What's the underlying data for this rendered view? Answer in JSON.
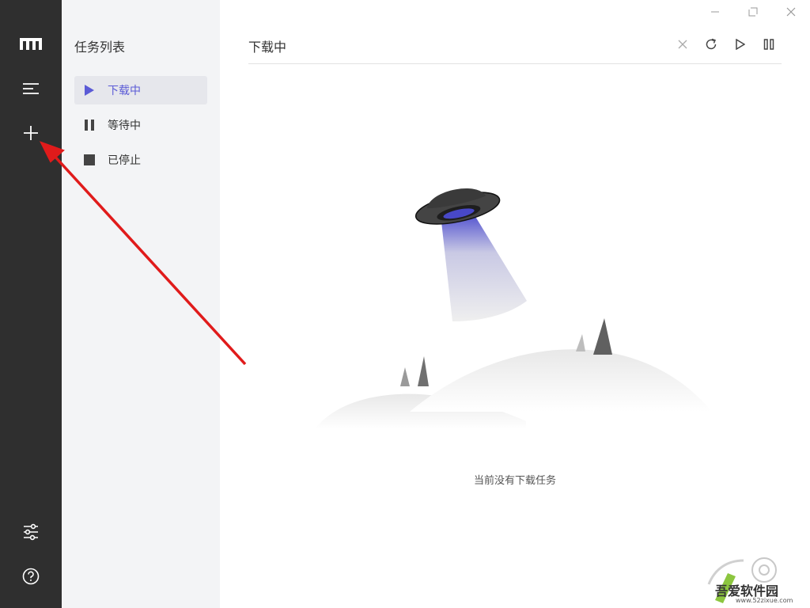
{
  "rail": {
    "logo_icon": "logo-m-icon",
    "menu_icon": "menu-lines-icon",
    "add_icon": "plus-icon",
    "settings_icon": "sliders-icon",
    "help_icon": "help-circle-icon"
  },
  "panel": {
    "title": "任务列表",
    "items": [
      {
        "label": "下载中",
        "icon": "play-icon",
        "active": true
      },
      {
        "label": "等待中",
        "icon": "pause-icon",
        "active": false
      },
      {
        "label": "已停止",
        "icon": "stop-icon",
        "active": false
      }
    ]
  },
  "main": {
    "title": "下载中",
    "actions": [
      "close-icon",
      "refresh-icon",
      "play-icon",
      "pause-icon"
    ],
    "window_controls": [
      "minimize-icon",
      "restore-icon",
      "window-close-icon"
    ],
    "empty_text": "当前没有下载任务"
  },
  "watermark": {
    "name": "吾爱软件园",
    "url": "www.52zixue.com"
  },
  "colors": {
    "rail": "#2f2f2f",
    "panel": "#f3f4f6",
    "accent": "#5b5bd6",
    "arrow": "#e01b1b"
  }
}
